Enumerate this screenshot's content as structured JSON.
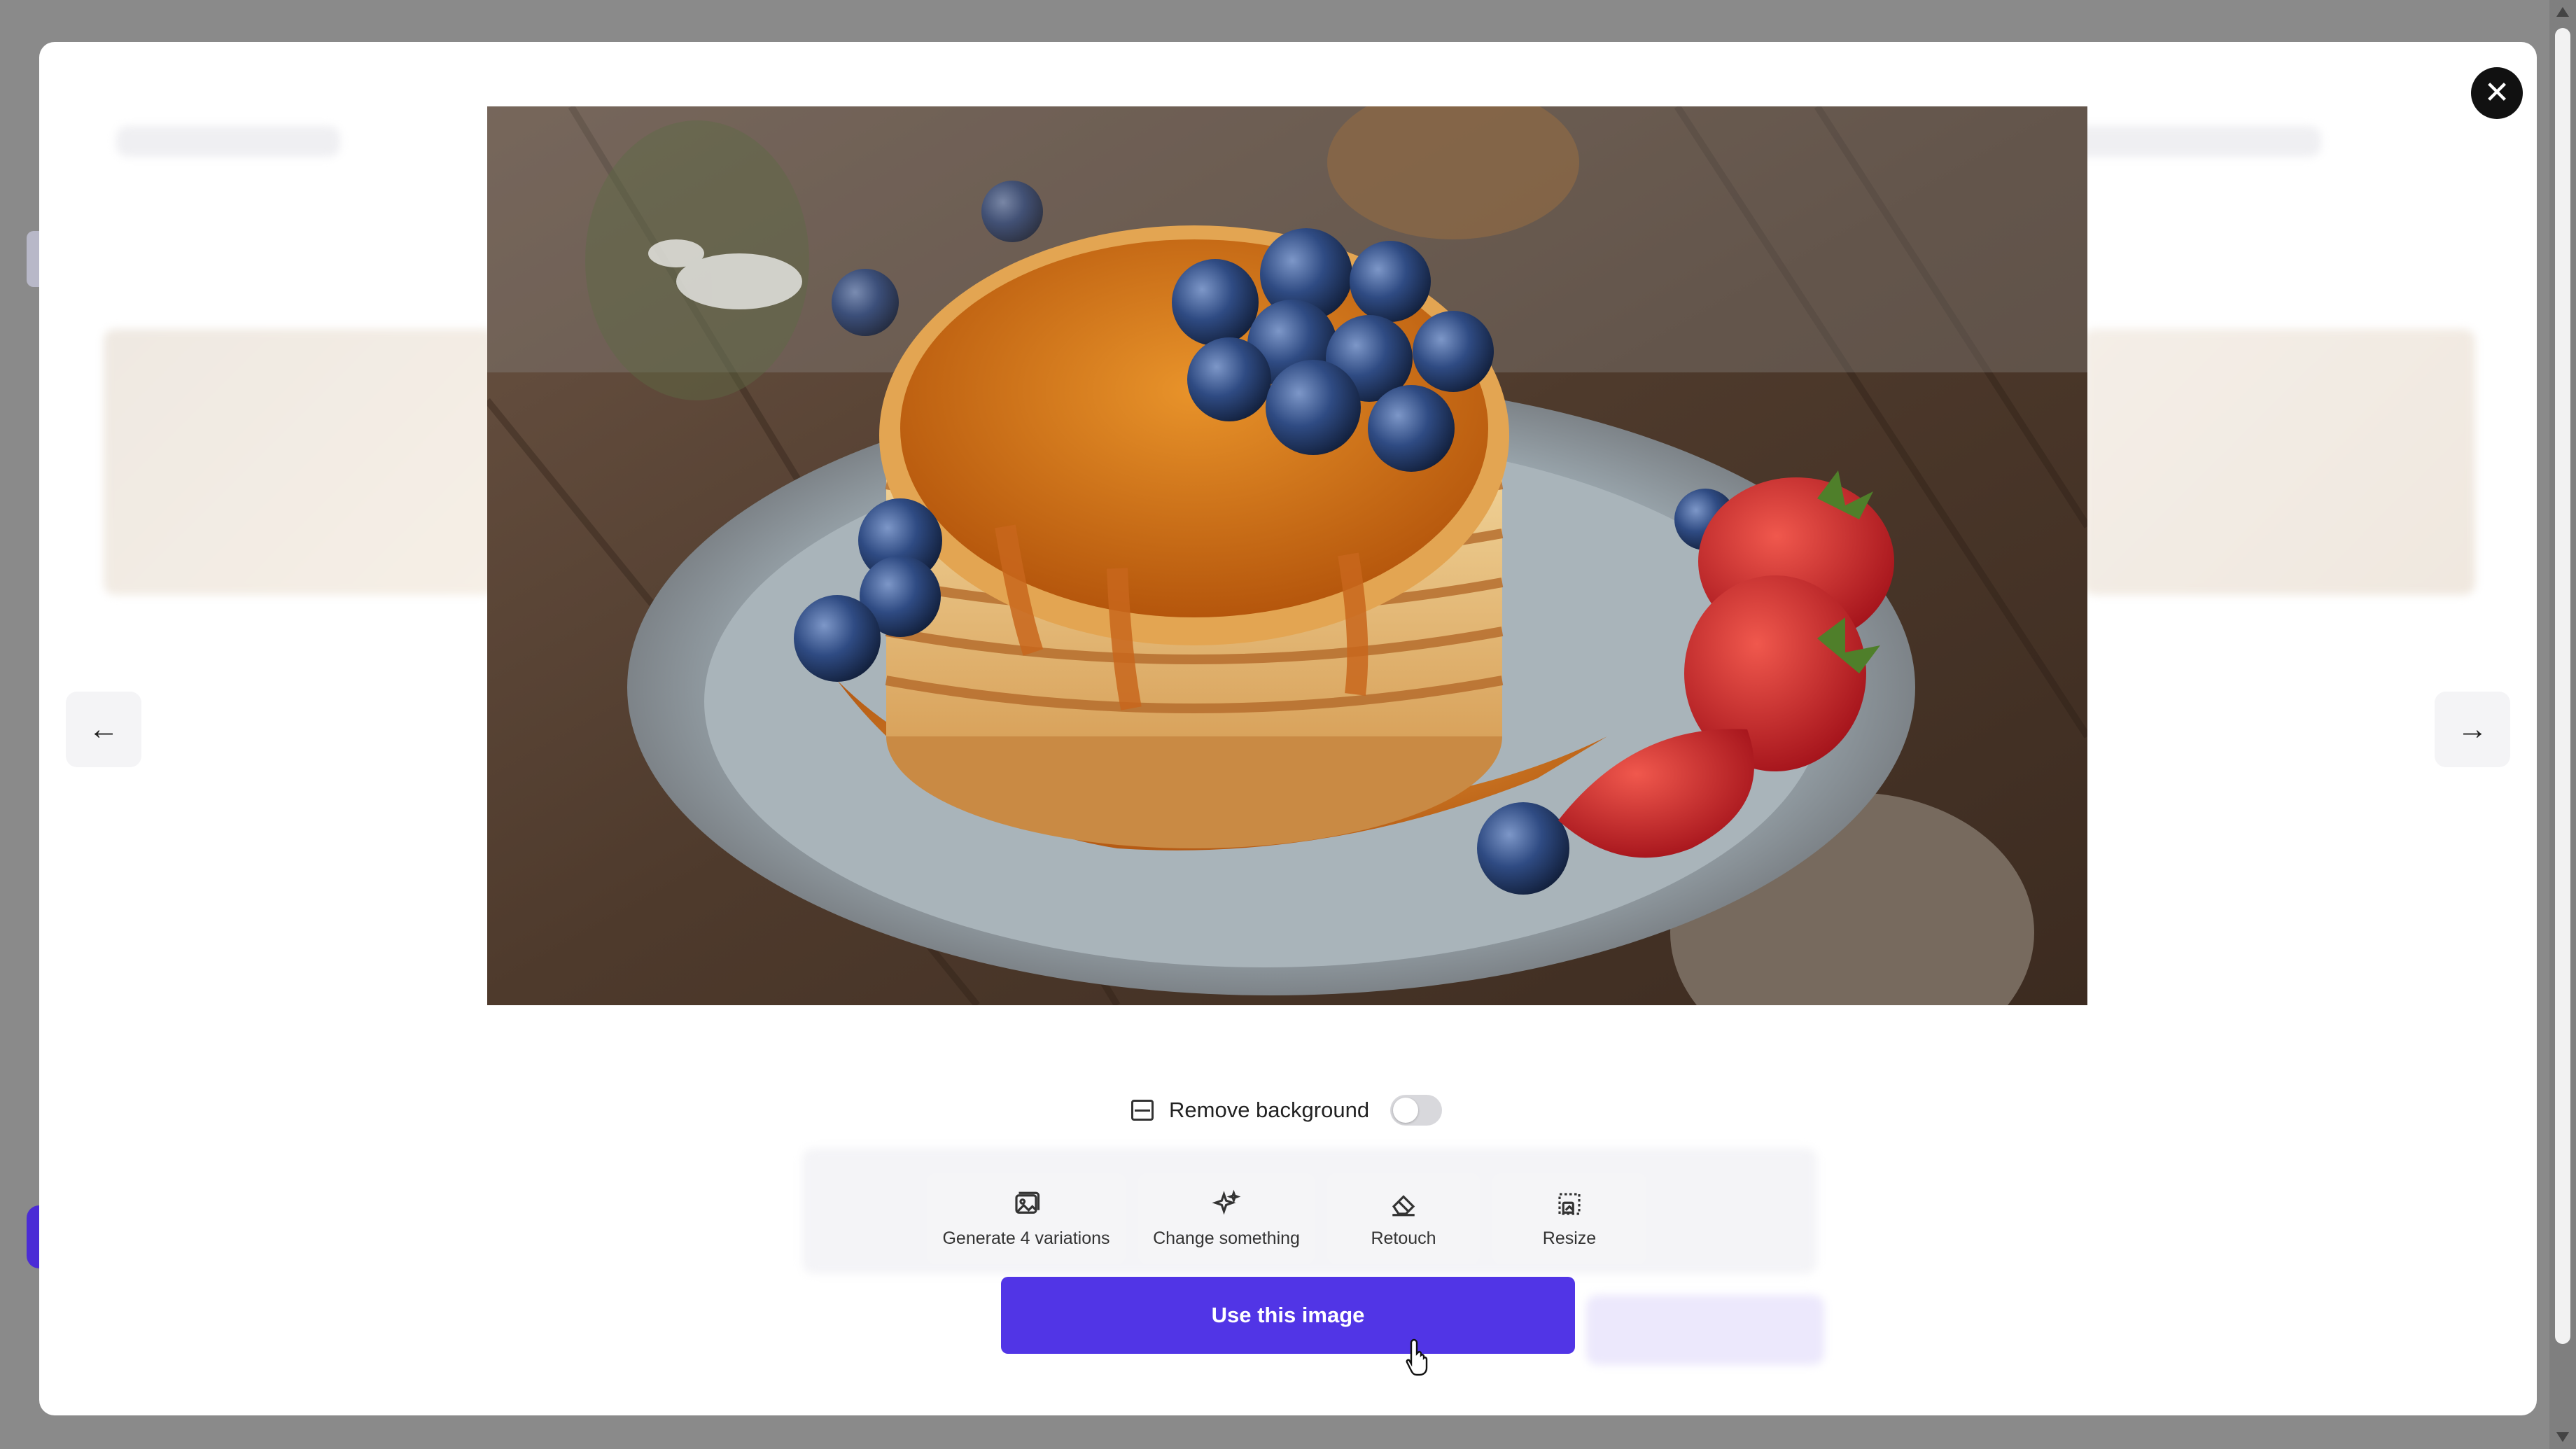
{
  "modal": {
    "close_icon": "✕",
    "prev_arrow": "←",
    "next_arrow": "→",
    "image": {
      "subject": "pancake-stack-with-blueberries-strawberries-and-syrup"
    },
    "remove_background": {
      "label": "Remove background",
      "enabled": false
    },
    "actions": [
      {
        "label": "Generate 4 variations",
        "icon": "image-variations-icon"
      },
      {
        "label": "Change something",
        "icon": "sparkle-icon"
      },
      {
        "label": "Retouch",
        "icon": "eraser-icon"
      },
      {
        "label": "Resize",
        "icon": "resize-icon"
      }
    ],
    "primary_button": "Use this image"
  },
  "colors": {
    "accent": "#5135e6",
    "close_bg": "#111111",
    "overlay": "#8a8a8a"
  }
}
